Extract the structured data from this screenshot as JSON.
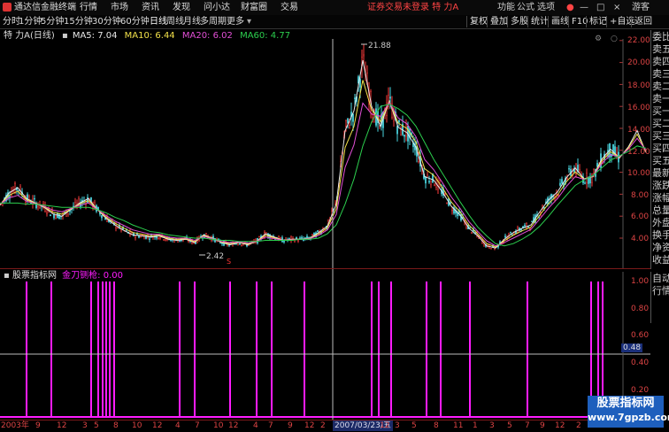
{
  "app": {
    "title": "通达信金融终端"
  },
  "menu": [
    "行情",
    "市场",
    "资讯",
    "发现",
    "问小达",
    "财富圈",
    "交易"
  ],
  "status_message": "证券交易未登录  特 力A",
  "window_controls": [
    "功能",
    "公式",
    "选项",
    "游客"
  ],
  "periods": [
    "分时",
    "1分钟",
    "5分钟",
    "15分钟",
    "30分钟",
    "60分钟",
    "日线",
    "周线",
    "月线",
    "多周期",
    "更多"
  ],
  "active_period": "日线",
  "right_tools": [
    "复权",
    "叠加",
    "多股",
    "统计",
    "画线",
    "F10",
    "标记",
    "+自选",
    "返回"
  ],
  "chart_legend": {
    "stock": "特 力A",
    "period_tag": "(日线)",
    "ma": [
      {
        "label": "MA5: 7.04",
        "color": "#e8e8e8"
      },
      {
        "label": "MA10: 6.44",
        "color": "#f2e14a"
      },
      {
        "label": "MA20: 6.02",
        "color": "#e24fd6"
      },
      {
        "label": "MA60: 4.77",
        "color": "#2ccf4e"
      }
    ]
  },
  "side_panel": [
    "委比",
    "卖五",
    "卖四",
    "卖三",
    "卖二",
    "卖一",
    "买一",
    "买二",
    "买三",
    "买四",
    "买五",
    "最新",
    "涨跌",
    "涨幅",
    "总量",
    "外盘",
    "换手",
    "净资",
    "收益"
  ],
  "side_panel_bottom": [
    "自动",
    "行情"
  ],
  "price_axis": [
    "22.00",
    "20.00",
    "18.00",
    "16.00",
    "14.00",
    "12.00",
    "10.00",
    "8.00",
    "6.00",
    "4.00"
  ],
  "annotations": {
    "high": "21.88",
    "low": "2.42"
  },
  "indicator": {
    "source": "股票指标网",
    "name": "金刀铡枪: 0.00",
    "axis": [
      "1.00",
      "0.80",
      "0.60",
      "0.40",
      "0.20"
    ],
    "cursor_value": "0.48"
  },
  "bottom_axis": [
    "2003年",
    "9",
    "12",
    "3",
    "5",
    "8",
    "10",
    "12",
    "4",
    "7",
    "10",
    "12",
    "4",
    "7",
    "9",
    "12",
    "2",
    "2007/03/23/五",
    "12",
    "3",
    "5",
    "8",
    "11",
    "1",
    "3",
    "5",
    "7",
    "9",
    "12",
    "2",
    "4",
    "6",
    "9"
  ],
  "watermark": {
    "line1": "股票指标网",
    "line2": "www.7gpzb.com"
  },
  "colors": {
    "up": "#ff3b3b",
    "down": "#4ad6e0",
    "signal": "#ff1cff"
  },
  "chart_data": {
    "type": "line",
    "title": "特 力A (日线)",
    "ylim": [
      2,
      22.5
    ],
    "x": [
      0,
      10,
      20,
      30,
      40,
      50,
      60,
      70,
      80,
      90,
      100,
      110,
      120,
      130,
      140,
      150,
      160,
      170,
      180,
      190,
      200,
      210,
      220,
      230,
      240,
      250,
      260,
      270,
      280,
      290,
      300,
      310,
      320,
      330,
      340,
      350,
      360,
      370,
      380,
      390,
      400,
      410,
      420,
      430,
      440,
      450,
      460,
      470,
      480,
      490,
      500,
      510,
      520,
      530,
      540,
      550,
      560,
      570,
      580,
      590,
      600,
      610,
      620,
      630,
      640,
      650,
      660,
      670,
      680,
      690,
      700,
      710,
      720,
      730
    ],
    "series": [
      {
        "name": "MA5",
        "values": [
          7.0,
          8.1,
          8.6,
          7.6,
          7.2,
          6.8,
          6.2,
          6.0,
          6.6,
          7.2,
          7.6,
          6.6,
          5.8,
          5.2,
          4.7,
          4.3,
          4.2,
          4.1,
          4.2,
          3.9,
          3.8,
          3.9,
          3.6,
          4.3,
          4.0,
          3.6,
          3.4,
          3.6,
          3.4,
          3.7,
          4.4,
          4.1,
          3.8,
          3.9,
          3.9,
          4.0,
          4.5,
          5.1,
          7.1,
          13.8,
          15.6,
          20.2,
          16.0,
          14.2,
          16.5,
          14.1,
          13.6,
          12.3,
          9.6,
          9.3,
          8.2,
          6.9,
          6.1,
          4.9,
          4.2,
          3.3,
          3.1,
          3.9,
          4.5,
          4.9,
          5.2,
          6.4,
          7.5,
          8.2,
          9.5,
          10.4,
          9.4,
          9.6,
          11.2,
          12.1,
          11.3,
          12.3,
          13.8,
          11.8
        ]
      },
      {
        "name": "MA60",
        "values": [
          7.2,
          7.2,
          7.2,
          7.1,
          7.1,
          7.0,
          6.9,
          6.8,
          6.8,
          6.8,
          6.8,
          6.6,
          6.3,
          5.9,
          5.6,
          5.2,
          4.9,
          4.6,
          4.5,
          4.3,
          4.2,
          4.1,
          4.0,
          4.0,
          3.9,
          3.8,
          3.8,
          3.7,
          3.7,
          3.7,
          3.8,
          3.8,
          3.8,
          3.8,
          3.9,
          3.9,
          4.0,
          4.4,
          5.2,
          7.1,
          9.4,
          12.4,
          14.6,
          16.0,
          16.2,
          15.8,
          15.2,
          14.2,
          12.7,
          11.2,
          9.9,
          8.6,
          7.3,
          6.1,
          5.0,
          4.2,
          3.5,
          3.3,
          3.5,
          3.9,
          4.4,
          5.1,
          6.0,
          7.0,
          7.9,
          8.8,
          9.3,
          9.7,
          10.4,
          11.1,
          11.5,
          11.9,
          12.4,
          12.2
        ]
      }
    ],
    "signal_x": [
      30,
      58,
      103,
      111,
      116,
      120,
      124,
      129,
      203,
      220,
      260,
      290,
      307,
      344,
      420,
      428,
      442,
      482,
      498,
      531,
      596,
      668,
      676,
      681
    ]
  }
}
